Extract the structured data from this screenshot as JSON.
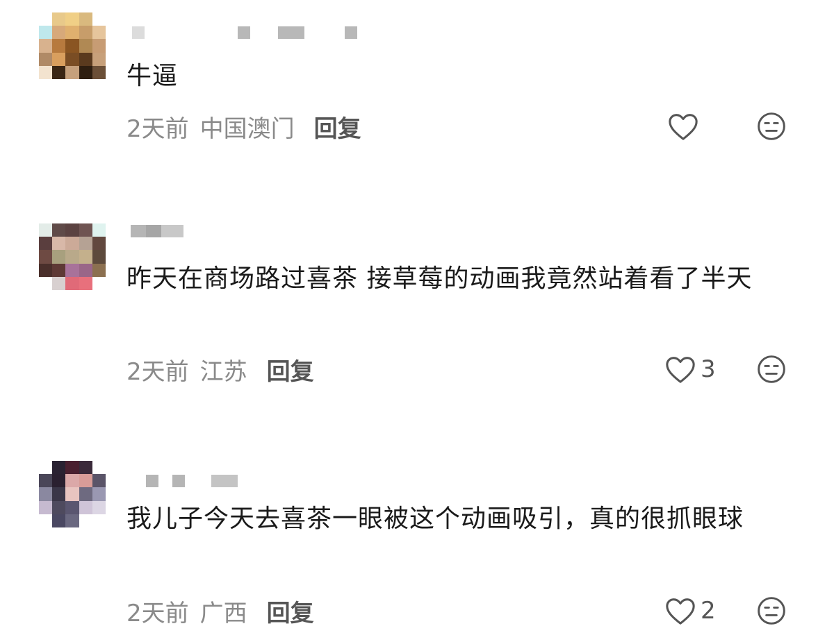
{
  "comments": [
    {
      "text": "牛逼",
      "time": "2天前",
      "region": "中国澳门",
      "reply_label": "回复",
      "like_count": ""
    },
    {
      "text": "昨天在商场路过喜茶 接草莓的动画我竟然站着看了半天",
      "time": "2天前",
      "region": "江苏",
      "reply_label": "回复",
      "like_count": "3"
    },
    {
      "text": "我儿子今天去喜茶一眼被这个动画吸引，真的很抓眼球",
      "time": "2天前",
      "region": "广西",
      "reply_label": "回复",
      "like_count": "2"
    }
  ],
  "icons": {
    "like": "heart-outline-icon",
    "dislike": "unamused-face-icon"
  },
  "colors": {
    "text": "#1a1a1a",
    "meta": "#8a8a8a",
    "reply": "#555555",
    "icon": "#555555"
  }
}
